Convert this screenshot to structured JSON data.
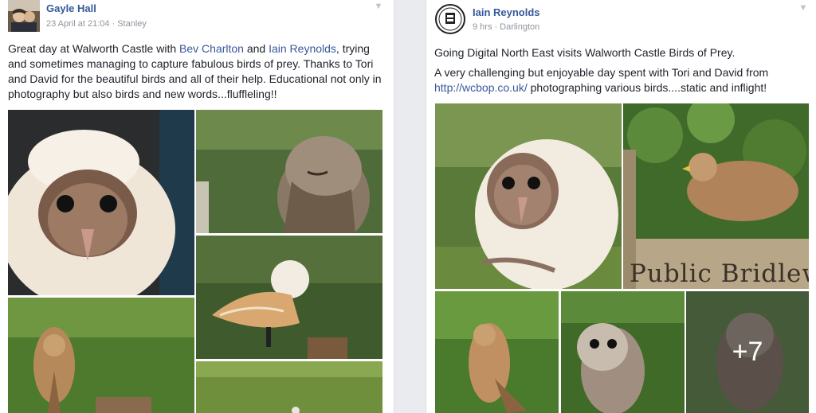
{
  "posts": [
    {
      "author": "Gayle Hall",
      "timestamp": "23 April at 21:04",
      "location": "Stanley",
      "text": {
        "part1": "Great day at Walworth Castle with ",
        "tag1": "Bev Charlton",
        "part2": " and ",
        "tag2": "Iain Reynolds",
        "part3": ", trying and sometimes managing to capture fabulous birds of prey. Thanks to Tori and David for the beautiful birds and all of their help. Educational not only in photography but also birds and new words...fluffleling!!"
      },
      "photos": [
        "owlet-photo",
        "tawny-owl-photo",
        "barn-owl-photo",
        "kestrel-photo",
        "grass-photo"
      ]
    },
    {
      "author": "Iain Reynolds",
      "timestamp": "9 hrs",
      "location": "Darlington",
      "text": {
        "line1": "Going Digital North East visits Walworth Castle Birds of Prey.",
        "line2a": "A very challenging but enjoyable day spent with Tori and David from ",
        "link": "http://wcbop.co.uk/",
        "line2b": " photographing various birds....static and inflight!"
      },
      "photo_sign_text": "Public Bridlew",
      "more_photos": "+7"
    }
  ],
  "colors": {
    "link": "#365899",
    "meta": "#90949c",
    "text": "#1d2129"
  }
}
